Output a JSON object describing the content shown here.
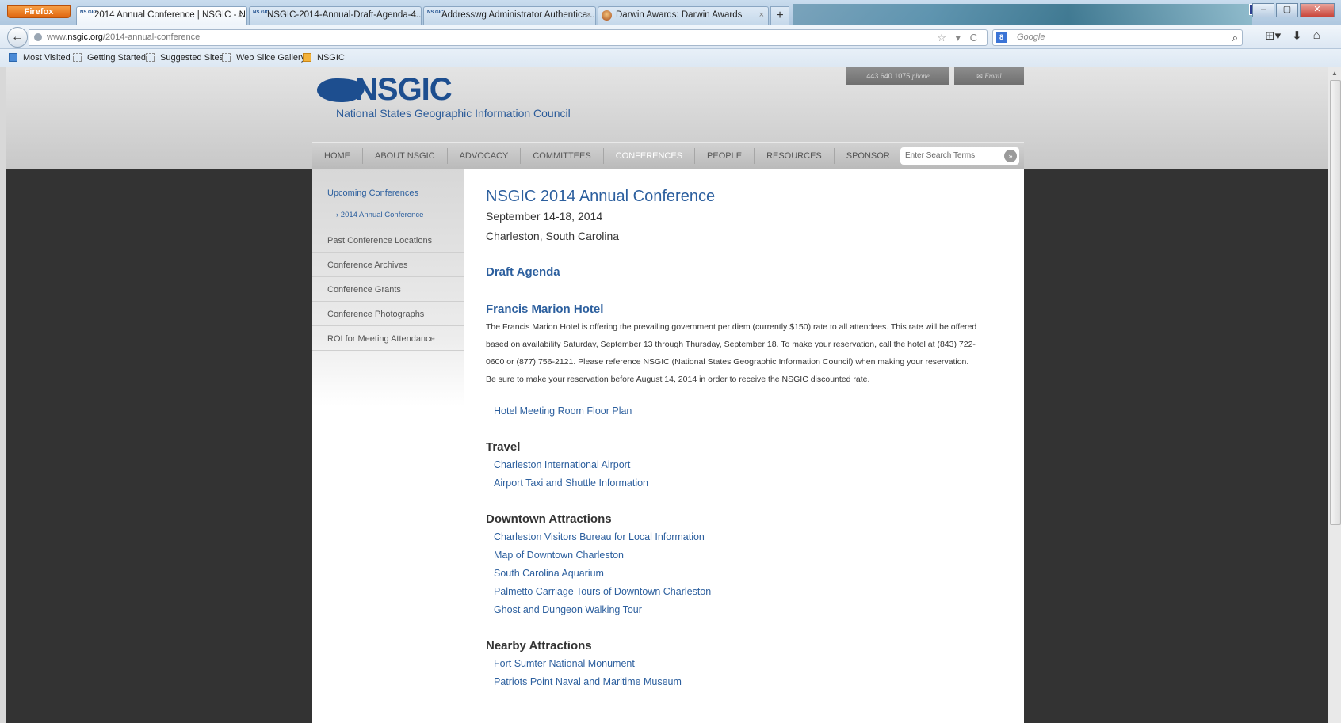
{
  "browser": {
    "menu_button": "Firefox",
    "tabs": [
      {
        "favicon": "NS GIC",
        "title": "2014 Annual Conference | NSGIC - Na...",
        "close": "×"
      },
      {
        "favicon": "NS GIC",
        "title": "NSGIC-2014-Annual-Draft-Agenda-4...",
        "close": "×"
      },
      {
        "favicon": "NS GIC",
        "title": "Addresswg Administrator Authentica...",
        "close": "×"
      },
      {
        "favicon": "",
        "title": "Darwin Awards: Darwin Awards",
        "close": "×"
      }
    ],
    "new_tab": "+",
    "window_controls": [
      "–",
      "▢",
      "✕"
    ],
    "back_icon": "←",
    "url_prefix": "www.",
    "url_domain": "nsgic.org",
    "url_path": "/2014-annual-conference",
    "url_icons": "☆ ▾ C",
    "search_engine_icon": "8",
    "search_placeholder": "Google",
    "search_icon": "⌕",
    "toolbar_icons": [
      "⊞▾",
      "⬇",
      "⌂"
    ],
    "bookmarks": [
      {
        "label": "Most Visited",
        "icon": "mv"
      },
      {
        "label": "Getting Started",
        "icon": ""
      },
      {
        "label": "Suggested Sites",
        "icon": ""
      },
      {
        "label": "Web Slice Gallery",
        "icon": ""
      },
      {
        "label": "NSGIC",
        "icon": "rss"
      }
    ]
  },
  "site": {
    "logo_text": "NSGIC",
    "logo_subtitle": "National States Geographic Information Council",
    "phone_number": "443.640.1075",
    "phone_label": "phone",
    "email_label": "Email",
    "nav": [
      "HOME",
      "ABOUT NSGIC",
      "ADVOCACY",
      "COMMITTEES",
      "CONFERENCES",
      "PEOPLE",
      "RESOURCES",
      "SPONSOR"
    ],
    "active_nav": "CONFERENCES",
    "search_placeholder": "Enter Search Terms",
    "search_go": "»"
  },
  "sidebar": {
    "heading": "Upcoming Conferences",
    "sub_item": "› 2014 Annual Conference",
    "items": [
      "Past Conference Locations",
      "Conference Archives",
      "Conference Grants",
      "Conference Photographs",
      "ROI for Meeting Attendance"
    ]
  },
  "main": {
    "title": "NSGIC 2014 Annual Conference",
    "dates": "September 14-18, 2014",
    "location": "Charleston, South Carolina",
    "draft_agenda": "Draft Agenda",
    "hotel_heading": "Francis Marion Hotel",
    "hotel_text": "The Francis Marion Hotel is offering the prevailing government per diem (currently $150) rate to all attendees. This rate will be offered based on availability Saturday, September 13 through Thursday, September 18. To make your reservation, call the hotel at (843) 722-0600 or (877) 756-2121. Please reference NSGIC (National States Geographic Information Council) when making your reservation. Be sure to make your reservation before August 14, 2014 in order to receive the NSGIC discounted rate.",
    "hotel_link": "Hotel Meeting Room Floor Plan",
    "travel_heading": "Travel",
    "travel_links": [
      "Charleston International Airport",
      "Airport Taxi and Shuttle Information"
    ],
    "downtown_heading": "Downtown Attractions",
    "downtown_links": [
      "Charleston Visitors Bureau for Local Information",
      "Map of Downtown Charleston",
      "South Carolina Aquarium",
      "Palmetto Carriage Tours of Downtown Charleston",
      "Ghost and Dungeon Walking Tour"
    ],
    "nearby_heading": "Nearby Attractions",
    "nearby_links": [
      "Fort Sumter National Monument",
      "Patriots Point Naval and Maritime Museum"
    ]
  }
}
